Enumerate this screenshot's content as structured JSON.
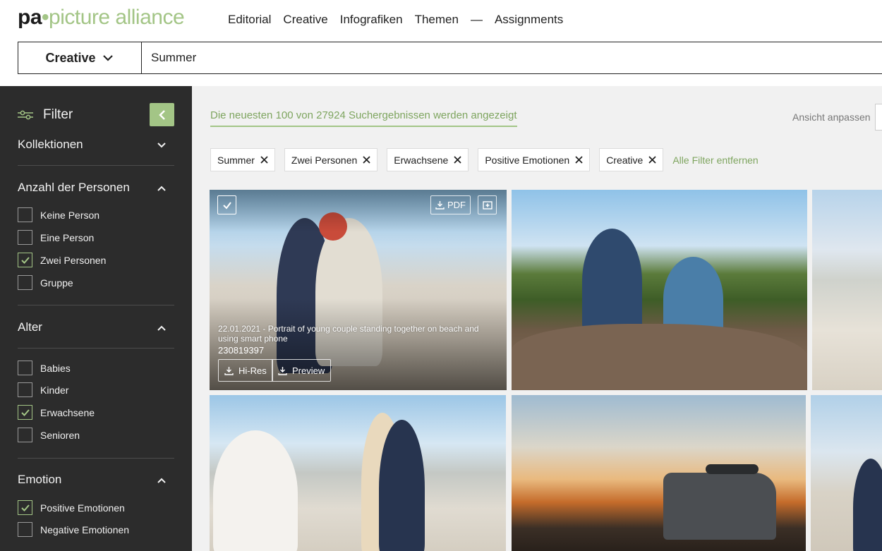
{
  "header": {
    "logo": {
      "pa": "pa",
      "dot": "•",
      "rest": "picture alliance"
    },
    "nav": [
      "Editorial",
      "Creative",
      "Infografiken",
      "Themen",
      "—",
      "Assignments"
    ],
    "search": {
      "scope": "Creative",
      "value": "Summer"
    }
  },
  "sidebar": {
    "filter_label": "Filter",
    "sections": [
      {
        "title": "Kollektionen",
        "expanded": false,
        "options": []
      },
      {
        "title": "Anzahl der Personen",
        "expanded": true,
        "options": [
          {
            "label": "Keine Person",
            "checked": false
          },
          {
            "label": "Eine Person",
            "checked": false
          },
          {
            "label": "Zwei Personen",
            "checked": true
          },
          {
            "label": "Gruppe",
            "checked": false
          }
        ]
      },
      {
        "title": "Alter",
        "expanded": true,
        "options": [
          {
            "label": "Babies",
            "checked": false
          },
          {
            "label": "Kinder",
            "checked": false
          },
          {
            "label": "Erwachsene",
            "checked": true
          },
          {
            "label": "Senioren",
            "checked": false
          }
        ]
      },
      {
        "title": "Emotion",
        "expanded": true,
        "options": [
          {
            "label": "Positive Emotionen",
            "checked": true
          },
          {
            "label": "Negative Emotionen",
            "checked": false
          }
        ]
      }
    ]
  },
  "main": {
    "results_text": "Die neuesten 100 von 27924 Suchergebnissen werden angezeigt",
    "view_label": "Ansicht anpassen",
    "chips": [
      "Summer",
      "Zwei Personen",
      "Erwachsene",
      "Positive Emotionen",
      "Creative"
    ],
    "remove_all": "Alle Filter entfernen",
    "featured": {
      "pdf_label": "PDF",
      "caption": "22.01.2021 - Portrait of young couple standing together on beach and using smart phone",
      "image_id": "230819397",
      "hires_label": "Hi-Res",
      "preview_label": "Preview"
    }
  },
  "colors": {
    "accent": "#a3c586",
    "accent_text": "#7ea55f",
    "sidebar_bg": "#2c2c2c",
    "main_bg": "#f1f1f1"
  }
}
